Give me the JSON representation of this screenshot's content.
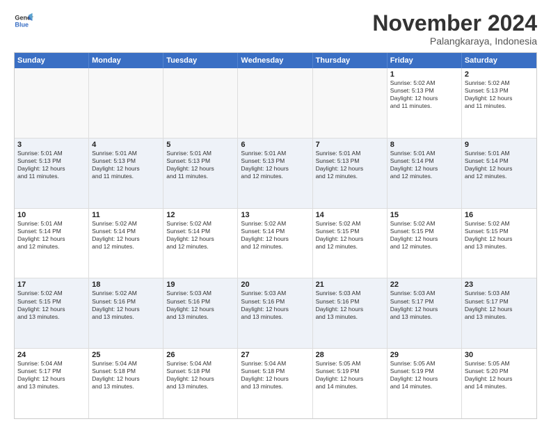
{
  "header": {
    "logo_line1": "General",
    "logo_line2": "Blue",
    "month": "November 2024",
    "location": "Palangkaraya, Indonesia"
  },
  "weekdays": [
    "Sunday",
    "Monday",
    "Tuesday",
    "Wednesday",
    "Thursday",
    "Friday",
    "Saturday"
  ],
  "rows": [
    [
      {
        "day": "",
        "text": ""
      },
      {
        "day": "",
        "text": ""
      },
      {
        "day": "",
        "text": ""
      },
      {
        "day": "",
        "text": ""
      },
      {
        "day": "",
        "text": ""
      },
      {
        "day": "1",
        "text": "Sunrise: 5:02 AM\nSunset: 5:13 PM\nDaylight: 12 hours\nand 11 minutes."
      },
      {
        "day": "2",
        "text": "Sunrise: 5:02 AM\nSunset: 5:13 PM\nDaylight: 12 hours\nand 11 minutes."
      }
    ],
    [
      {
        "day": "3",
        "text": "Sunrise: 5:01 AM\nSunset: 5:13 PM\nDaylight: 12 hours\nand 11 minutes."
      },
      {
        "day": "4",
        "text": "Sunrise: 5:01 AM\nSunset: 5:13 PM\nDaylight: 12 hours\nand 11 minutes."
      },
      {
        "day": "5",
        "text": "Sunrise: 5:01 AM\nSunset: 5:13 PM\nDaylight: 12 hours\nand 11 minutes."
      },
      {
        "day": "6",
        "text": "Sunrise: 5:01 AM\nSunset: 5:13 PM\nDaylight: 12 hours\nand 12 minutes."
      },
      {
        "day": "7",
        "text": "Sunrise: 5:01 AM\nSunset: 5:13 PM\nDaylight: 12 hours\nand 12 minutes."
      },
      {
        "day": "8",
        "text": "Sunrise: 5:01 AM\nSunset: 5:14 PM\nDaylight: 12 hours\nand 12 minutes."
      },
      {
        "day": "9",
        "text": "Sunrise: 5:01 AM\nSunset: 5:14 PM\nDaylight: 12 hours\nand 12 minutes."
      }
    ],
    [
      {
        "day": "10",
        "text": "Sunrise: 5:01 AM\nSunset: 5:14 PM\nDaylight: 12 hours\nand 12 minutes."
      },
      {
        "day": "11",
        "text": "Sunrise: 5:02 AM\nSunset: 5:14 PM\nDaylight: 12 hours\nand 12 minutes."
      },
      {
        "day": "12",
        "text": "Sunrise: 5:02 AM\nSunset: 5:14 PM\nDaylight: 12 hours\nand 12 minutes."
      },
      {
        "day": "13",
        "text": "Sunrise: 5:02 AM\nSunset: 5:14 PM\nDaylight: 12 hours\nand 12 minutes."
      },
      {
        "day": "14",
        "text": "Sunrise: 5:02 AM\nSunset: 5:15 PM\nDaylight: 12 hours\nand 12 minutes."
      },
      {
        "day": "15",
        "text": "Sunrise: 5:02 AM\nSunset: 5:15 PM\nDaylight: 12 hours\nand 12 minutes."
      },
      {
        "day": "16",
        "text": "Sunrise: 5:02 AM\nSunset: 5:15 PM\nDaylight: 12 hours\nand 13 minutes."
      }
    ],
    [
      {
        "day": "17",
        "text": "Sunrise: 5:02 AM\nSunset: 5:15 PM\nDaylight: 12 hours\nand 13 minutes."
      },
      {
        "day": "18",
        "text": "Sunrise: 5:02 AM\nSunset: 5:16 PM\nDaylight: 12 hours\nand 13 minutes."
      },
      {
        "day": "19",
        "text": "Sunrise: 5:03 AM\nSunset: 5:16 PM\nDaylight: 12 hours\nand 13 minutes."
      },
      {
        "day": "20",
        "text": "Sunrise: 5:03 AM\nSunset: 5:16 PM\nDaylight: 12 hours\nand 13 minutes."
      },
      {
        "day": "21",
        "text": "Sunrise: 5:03 AM\nSunset: 5:16 PM\nDaylight: 12 hours\nand 13 minutes."
      },
      {
        "day": "22",
        "text": "Sunrise: 5:03 AM\nSunset: 5:17 PM\nDaylight: 12 hours\nand 13 minutes."
      },
      {
        "day": "23",
        "text": "Sunrise: 5:03 AM\nSunset: 5:17 PM\nDaylight: 12 hours\nand 13 minutes."
      }
    ],
    [
      {
        "day": "24",
        "text": "Sunrise: 5:04 AM\nSunset: 5:17 PM\nDaylight: 12 hours\nand 13 minutes."
      },
      {
        "day": "25",
        "text": "Sunrise: 5:04 AM\nSunset: 5:18 PM\nDaylight: 12 hours\nand 13 minutes."
      },
      {
        "day": "26",
        "text": "Sunrise: 5:04 AM\nSunset: 5:18 PM\nDaylight: 12 hours\nand 13 minutes."
      },
      {
        "day": "27",
        "text": "Sunrise: 5:04 AM\nSunset: 5:18 PM\nDaylight: 12 hours\nand 13 minutes."
      },
      {
        "day": "28",
        "text": "Sunrise: 5:05 AM\nSunset: 5:19 PM\nDaylight: 12 hours\nand 14 minutes."
      },
      {
        "day": "29",
        "text": "Sunrise: 5:05 AM\nSunset: 5:19 PM\nDaylight: 12 hours\nand 14 minutes."
      },
      {
        "day": "30",
        "text": "Sunrise: 5:05 AM\nSunset: 5:20 PM\nDaylight: 12 hours\nand 14 minutes."
      }
    ]
  ]
}
